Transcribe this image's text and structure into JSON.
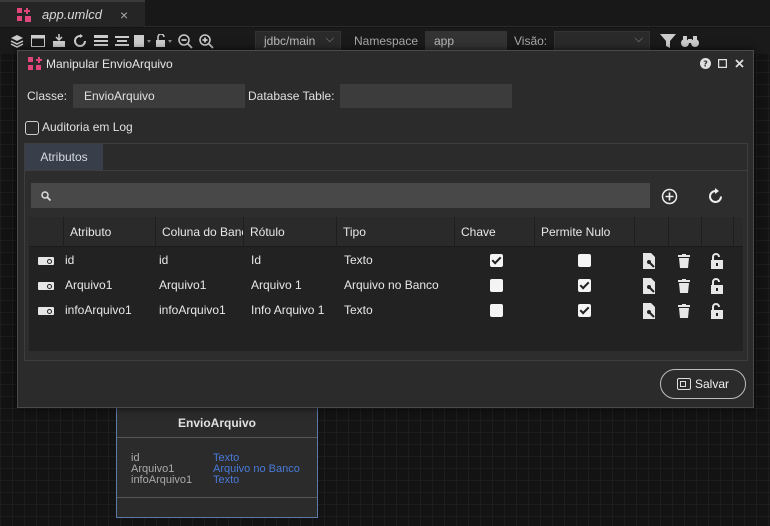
{
  "tab": {
    "title": "app.umlcd",
    "close": "×"
  },
  "toolbar": {
    "connection": "jdbc/main",
    "namespace_label": "Namespace",
    "namespace_value": "app",
    "view_label": "Visão:",
    "view_value": ""
  },
  "background_entity": {
    "name": "EnvioArquivo",
    "rows": [
      {
        "name": "id",
        "type": "Texto"
      },
      {
        "name": "Arquivo1",
        "type": "Arquivo no Banco"
      },
      {
        "name": "infoArquivo1",
        "type": "Texto"
      }
    ]
  },
  "dialog": {
    "title": "Manipular EnvioArquivo",
    "class_label": "Classe:",
    "class_value": "EnvioArquivo",
    "db_table_label": "Database Table:",
    "db_table_value": "",
    "audit_label": "Auditoria em Log",
    "audit_checked": false,
    "tab_label": "Atributos",
    "search_placeholder": "",
    "columns": [
      "Atributo",
      "Coluna do Banco",
      "Rótulo",
      "Tipo",
      "Chave",
      "Permite Nulo"
    ],
    "rows": [
      {
        "atributo": "id",
        "coluna": "id",
        "rotulo": "Id",
        "tipo": "Texto",
        "chave": true,
        "nulo": false
      },
      {
        "atributo": "Arquivo1",
        "coluna": "Arquivo1",
        "rotulo": "Arquivo 1",
        "tipo": "Arquivo no Banco",
        "chave": false,
        "nulo": true
      },
      {
        "atributo": "infoArquivo1",
        "coluna": "infoArquivo1",
        "rotulo": "Info Arquivo 1",
        "tipo": "Texto",
        "chave": false,
        "nulo": true
      }
    ],
    "save_label": "Salvar"
  },
  "colors": {
    "accent_pink": "#e0457b",
    "entity_border": "#5a7aa8",
    "type_blue": "#4a7ad8"
  }
}
